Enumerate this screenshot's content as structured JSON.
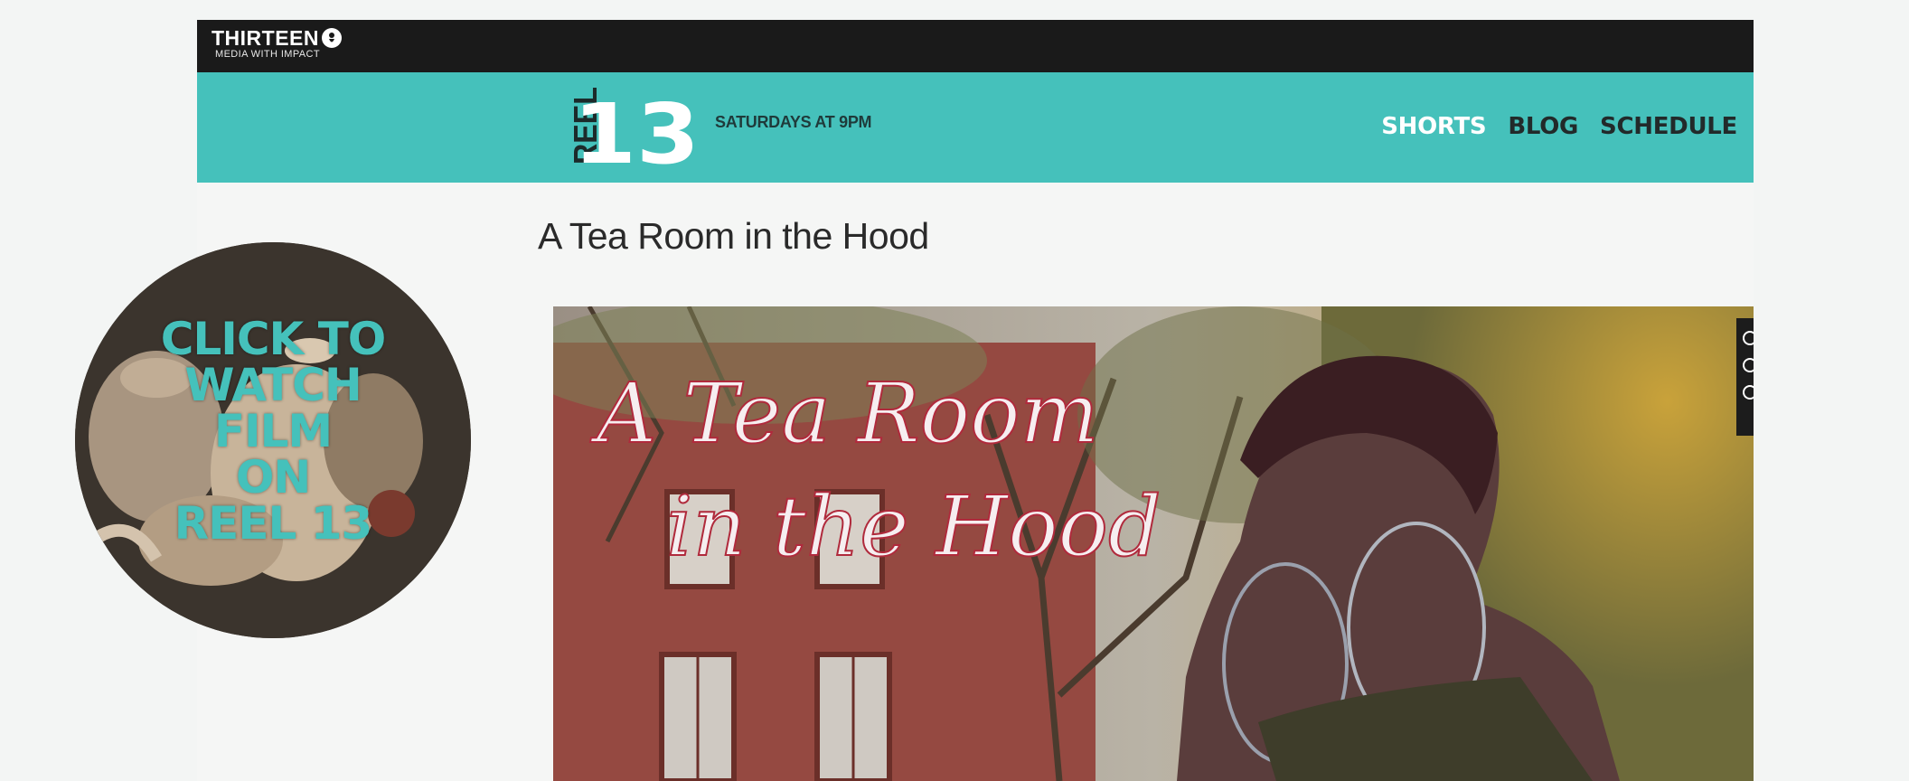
{
  "site": {
    "network_name": "THIRTEEN",
    "network_tagline": "MEDIA WITH IMPACT",
    "show_name": "REEL 13",
    "show_logo_left": "REEL",
    "show_logo_right": "13",
    "airtime": "SATURDAYS AT 9PM"
  },
  "nav": {
    "items": [
      "SHORTS",
      "BLOG",
      "SCHEDULE"
    ]
  },
  "page": {
    "title": "A Tea Room in the Hood"
  },
  "video": {
    "overlay_line1": "A Tea Room",
    "overlay_line2": "in the Hood"
  },
  "promo": {
    "lines": [
      "CLICK TO",
      "WATCH",
      "FILM",
      "ON",
      "REEL 13"
    ]
  },
  "colors": {
    "teal": "#45c1bb",
    "topbar": "#1a1a1a",
    "background": "#f3f5f4"
  },
  "icons": [
    "pbs-icon",
    "share-icon",
    "comment-icon",
    "like-icon"
  ]
}
